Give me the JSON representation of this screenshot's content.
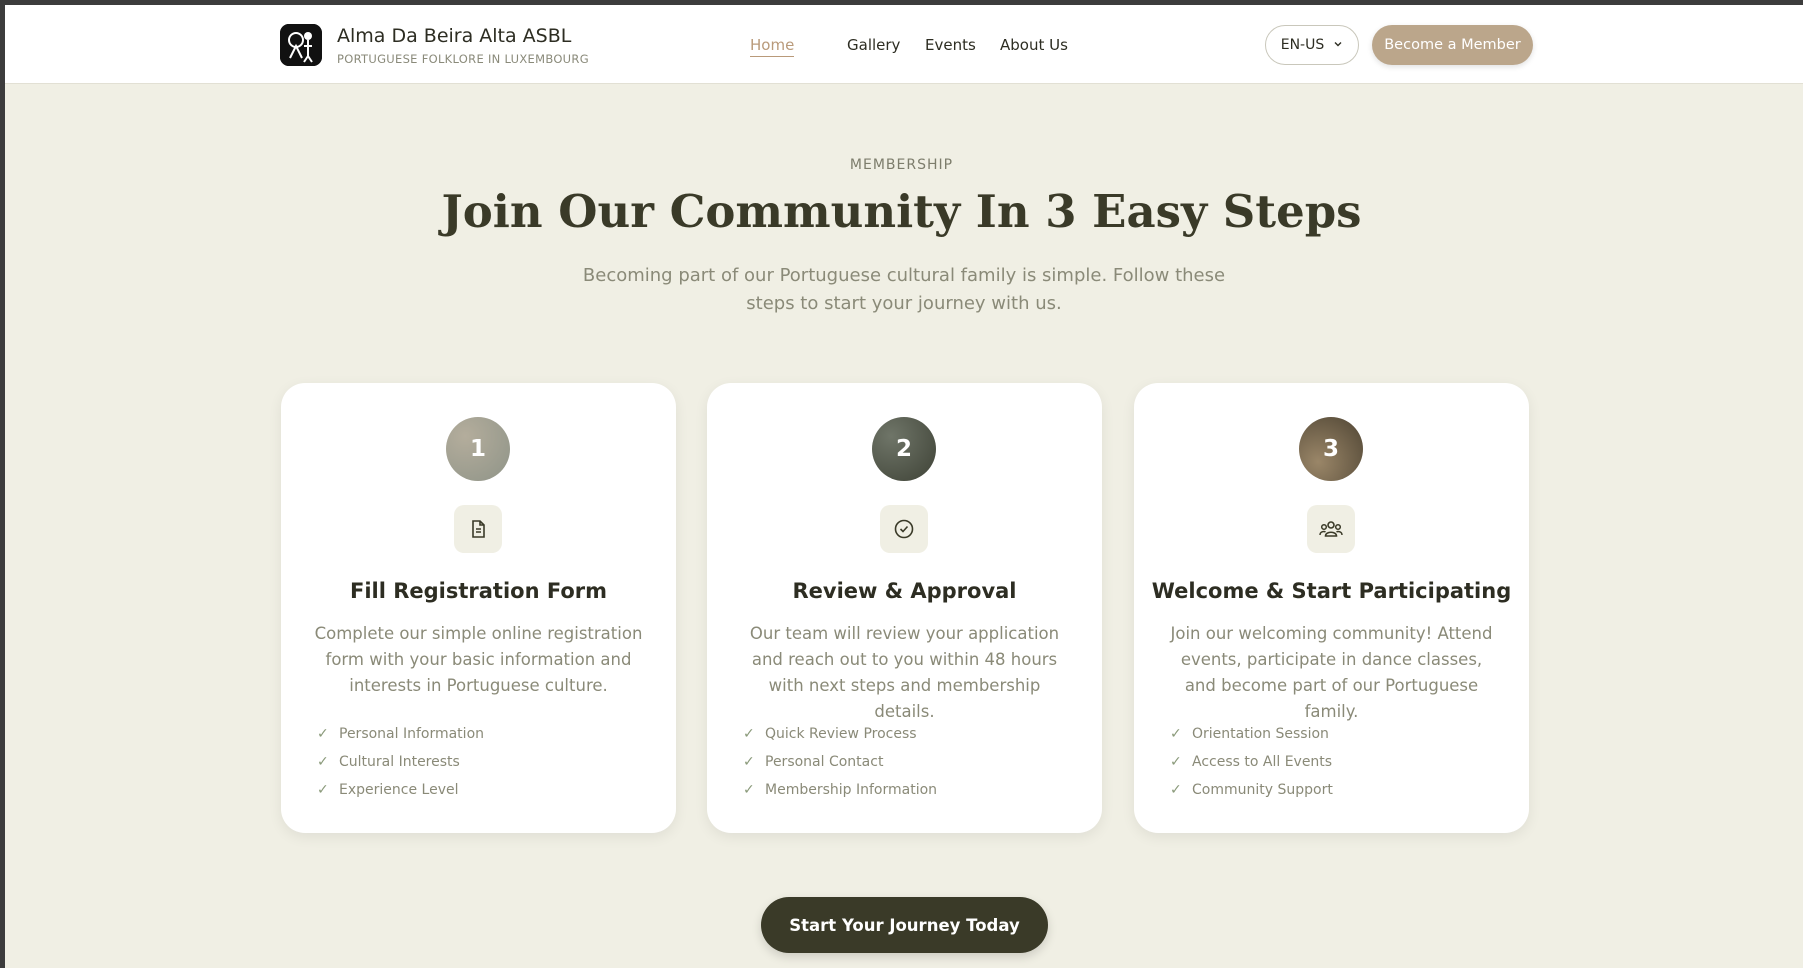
{
  "header": {
    "brand_name": "Alma Da Beira Alta ASBL",
    "brand_sub": "PORTUGUESE FOLKLORE IN LUXEMBOURG",
    "nav": [
      "Home",
      "Gallery",
      "Events",
      "About Us"
    ],
    "active_nav": "Home",
    "language": "EN-US",
    "member_button": "Become a Member"
  },
  "hero": {
    "eyebrow": "MEMBERSHIP",
    "title": "Join Our Community In 3 Easy Steps",
    "intro": "Becoming part of our Portuguese cultural family is simple. Follow these steps to start your journey with us."
  },
  "steps": [
    {
      "number": "1",
      "icon": "document-icon",
      "title": "Fill Registration Form",
      "description": "Complete our simple online registration form with your basic information and interests in Portuguese culture.",
      "items": [
        "Personal Information",
        "Cultural Interests",
        "Experience Level"
      ]
    },
    {
      "number": "2",
      "icon": "check-circle-icon",
      "title": "Review & Approval",
      "description": "Our team will review your application and reach out to you within 48 hours with next steps and membership details.",
      "items": [
        "Quick Review Process",
        "Personal Contact",
        "Membership Information"
      ]
    },
    {
      "number": "3",
      "icon": "users-icon",
      "title": "Welcome & Start Participating",
      "description": "Join our welcoming community! Attend events, participate in dance classes, and become part of our Portuguese family.",
      "items": [
        "Orientation Session",
        "Access to All Events",
        "Community Support"
      ]
    }
  ],
  "cta": "Start Your Journey Today",
  "colors": {
    "background": "#f0efe4",
    "accent": "#bba68b",
    "dark": "#3a3a28",
    "step1": "#a09a8c",
    "step2": "#4f5548",
    "step3": "#6e6048"
  }
}
